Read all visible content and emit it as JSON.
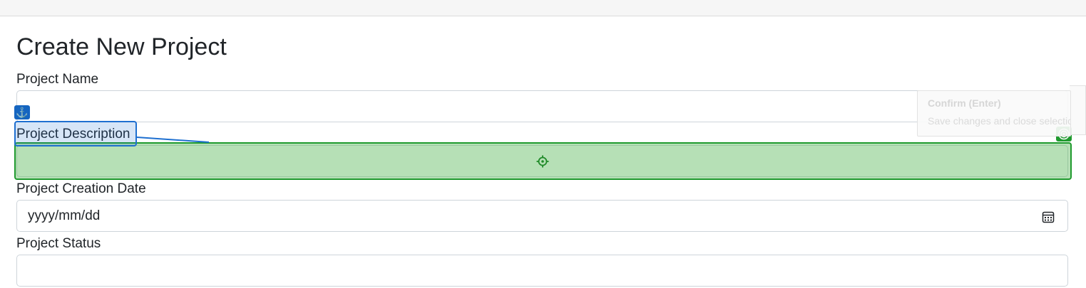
{
  "form": {
    "title": "Create New Project",
    "fields": [
      {
        "label": "Project Name",
        "value": ""
      },
      {
        "label": "Project Description",
        "value": ""
      },
      {
        "label": "Project Creation Date",
        "placeholder": "yyyy/mm/dd"
      },
      {
        "label": "Project Status",
        "value": ""
      }
    ]
  },
  "overlay": {
    "anchor_icon": "⚓",
    "tooltip": {
      "title": "Confirm (Enter)",
      "subtitle": "Save changes and close selection"
    },
    "colors": {
      "anchor": "#1565c0",
      "source_highlight": "#1e6fd0",
      "target_zone": "#1f9a2e"
    }
  },
  "icons": [
    "calendar-icon",
    "anchor-icon",
    "target-icon",
    "crosshair-icon"
  ]
}
